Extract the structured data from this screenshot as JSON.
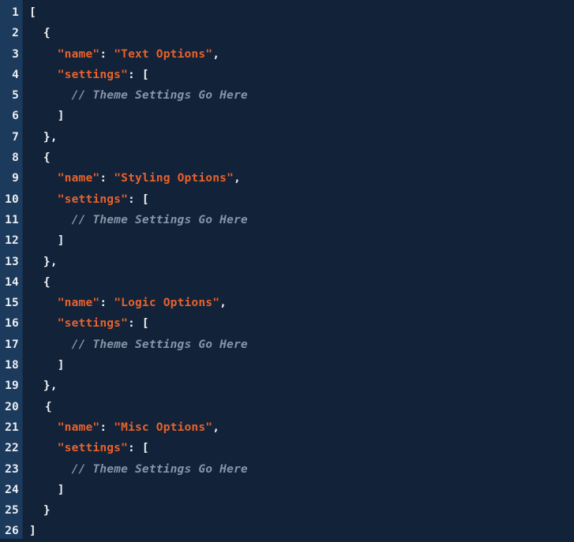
{
  "editor": {
    "language": "json",
    "total_lines": 26,
    "colors": {
      "background": "#122239",
      "gutter_background": "#1c3a5c",
      "line_number": "#eaeef4",
      "string": "#e8622a",
      "punctuation": "#f0f2f5",
      "comment": "#8795a8"
    }
  },
  "line_numbers": [
    "1",
    "2",
    "3",
    "4",
    "5",
    "6",
    "7",
    "8",
    "9",
    "10",
    "11",
    "12",
    "13",
    "14",
    "15",
    "16",
    "17",
    "18",
    "19",
    "20",
    "21",
    "22",
    "23",
    "24",
    "25",
    "26"
  ],
  "code_lines": [
    {
      "n": "1",
      "indent": "",
      "tokens": [
        {
          "t": "punct",
          "v": "["
        }
      ]
    },
    {
      "n": "2",
      "indent": "  ",
      "tokens": [
        {
          "t": "punct",
          "v": "{"
        }
      ]
    },
    {
      "n": "3",
      "indent": "    ",
      "tokens": [
        {
          "t": "str",
          "v": "\"name\""
        },
        {
          "t": "punct",
          "v": ": "
        },
        {
          "t": "str",
          "v": "\"Text Options\""
        },
        {
          "t": "punct",
          "v": ","
        }
      ]
    },
    {
      "n": "4",
      "indent": "    ",
      "tokens": [
        {
          "t": "str",
          "v": "\"settings\""
        },
        {
          "t": "punct",
          "v": ": ["
        }
      ]
    },
    {
      "n": "5",
      "indent": "      ",
      "tokens": [
        {
          "t": "com",
          "v": "// Theme Settings Go Here"
        }
      ]
    },
    {
      "n": "6",
      "indent": "    ",
      "tokens": [
        {
          "t": "punct",
          "v": "]"
        }
      ]
    },
    {
      "n": "7",
      "indent": "  ",
      "tokens": [
        {
          "t": "punct",
          "v": "},"
        }
      ]
    },
    {
      "n": "8",
      "indent": "  ",
      "tokens": [
        {
          "t": "punct",
          "v": "{"
        }
      ]
    },
    {
      "n": "9",
      "indent": "    ",
      "tokens": [
        {
          "t": "str",
          "v": "\"name\""
        },
        {
          "t": "punct",
          "v": ": "
        },
        {
          "t": "str",
          "v": "\"Styling Options\""
        },
        {
          "t": "punct",
          "v": ","
        }
      ]
    },
    {
      "n": "10",
      "indent": "    ",
      "tokens": [
        {
          "t": "str",
          "v": "\"settings\""
        },
        {
          "t": "punct",
          "v": ": ["
        }
      ]
    },
    {
      "n": "11",
      "indent": "      ",
      "tokens": [
        {
          "t": "com",
          "v": "// Theme Settings Go Here"
        }
      ]
    },
    {
      "n": "12",
      "indent": "    ",
      "tokens": [
        {
          "t": "punct",
          "v": "]"
        }
      ]
    },
    {
      "n": "13",
      "indent": "  ",
      "tokens": [
        {
          "t": "punct",
          "v": "},"
        }
      ]
    },
    {
      "n": "14",
      "indent": "  ",
      "tokens": [
        {
          "t": "punct",
          "v": "{"
        }
      ]
    },
    {
      "n": "15",
      "indent": "    ",
      "tokens": [
        {
          "t": "str",
          "v": "\"name\""
        },
        {
          "t": "punct",
          "v": ": "
        },
        {
          "t": "str",
          "v": "\"Logic Options\""
        },
        {
          "t": "punct",
          "v": ","
        }
      ]
    },
    {
      "n": "16",
      "indent": "    ",
      "tokens": [
        {
          "t": "str",
          "v": "\"settings\""
        },
        {
          "t": "punct",
          "v": ": ["
        }
      ]
    },
    {
      "n": "17",
      "indent": "      ",
      "tokens": [
        {
          "t": "com",
          "v": "// Theme Settings Go Here"
        }
      ]
    },
    {
      "n": "18",
      "indent": "    ",
      "tokens": [
        {
          "t": "punct",
          "v": "]"
        }
      ]
    },
    {
      "n": "19",
      "indent": "  ",
      "tokens": [
        {
          "t": "punct",
          "v": "},"
        }
      ]
    },
    {
      "n": "20",
      "indent": "  ",
      "nudge": true,
      "tokens": [
        {
          "t": "punct",
          "v": "{"
        }
      ]
    },
    {
      "n": "21",
      "indent": "    ",
      "tokens": [
        {
          "t": "str",
          "v": "\"name\""
        },
        {
          "t": "punct",
          "v": ": "
        },
        {
          "t": "str",
          "v": "\"Misc Options\""
        },
        {
          "t": "punct",
          "v": ","
        }
      ]
    },
    {
      "n": "22",
      "indent": "    ",
      "tokens": [
        {
          "t": "str",
          "v": "\"settings\""
        },
        {
          "t": "punct",
          "v": ": ["
        }
      ]
    },
    {
      "n": "23",
      "indent": "      ",
      "tokens": [
        {
          "t": "com",
          "v": "// Theme Settings Go Here"
        }
      ]
    },
    {
      "n": "24",
      "indent": "    ",
      "tokens": [
        {
          "t": "punct",
          "v": "]"
        }
      ]
    },
    {
      "n": "25",
      "indent": "  ",
      "tokens": [
        {
          "t": "punct",
          "v": "}"
        }
      ]
    },
    {
      "n": "26",
      "indent": "",
      "tokens": [
        {
          "t": "punct",
          "v": "]"
        }
      ]
    }
  ]
}
